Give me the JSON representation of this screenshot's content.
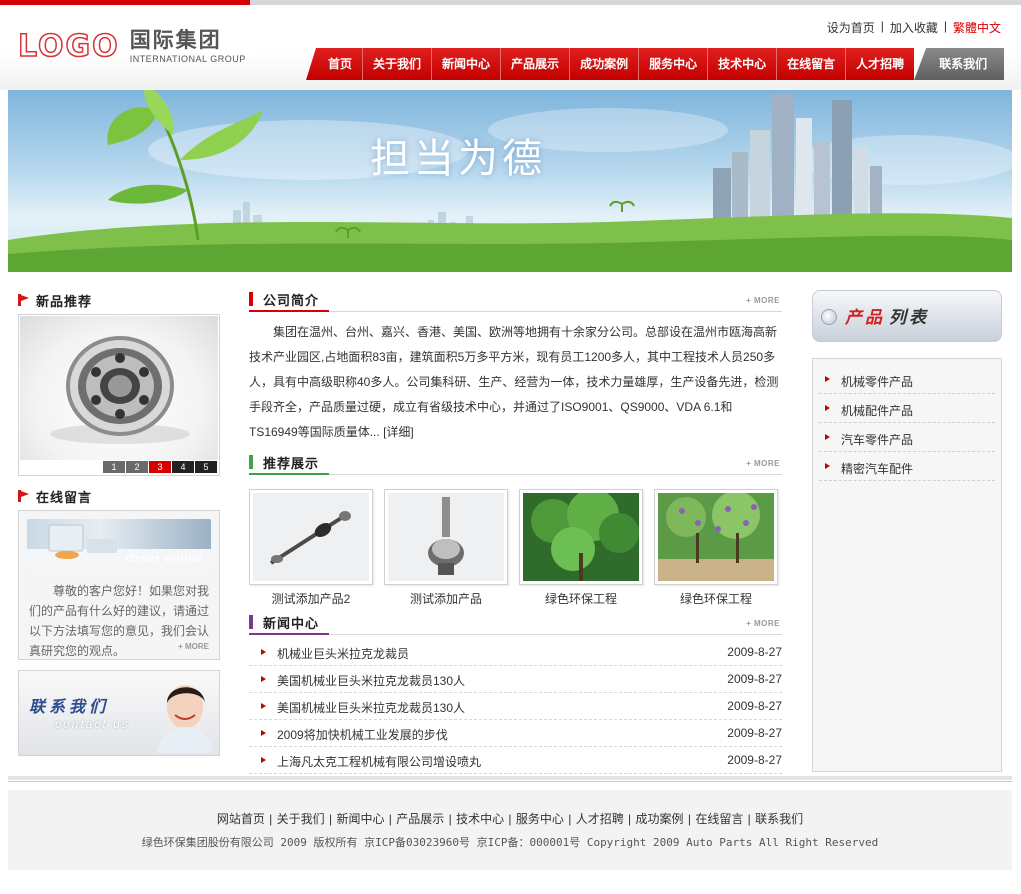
{
  "header": {
    "logo_mark": "LOGO",
    "logo_cn": "国际集团",
    "logo_en": "INTERNATIONAL GROUP",
    "top_links": [
      "设为首页",
      "加入收藏",
      "繁體中文"
    ],
    "nav": [
      "首页",
      "关于我们",
      "新闻中心",
      "产品展示",
      "成功案例",
      "服务中心",
      "技术中心",
      "在线留言",
      "人才招聘"
    ],
    "nav_contact": "联系我们"
  },
  "banner": {
    "slogan": "担当为德"
  },
  "left": {
    "new_products_title": "新品推荐",
    "slide_numbers": [
      "1",
      "2",
      "3",
      "4",
      "5"
    ],
    "active_slide": 3,
    "message_title": "在线留言",
    "order_online": "Order online",
    "message_text": "尊敬的客户您好！如果您对我们的产品有什么好的建议，请通过以下方法填写您的意见，我们会认真研究您的观点。",
    "message_more": "+ MORE",
    "contact_cn": "联系我们",
    "contact_en": "contact us"
  },
  "intro": {
    "title": "公司简介",
    "more": "+ MORE",
    "text": "集团在温州、台州、嘉兴、香港、美国、欧洲等地拥有十余家分公司。总部设在温州市瓯海高新技术产业园区,占地面积83亩，建筑面积5万多平方米，现有员工1200多人，其中工程技术人员250多人，具有中高级职称40多人。公司集科研、生产、经营为一体，技术力量雄厚，生产设备先进，检测手段齐全，产品质量过硬，成立有省级技术中心，并通过了ISO9001、QS9000、VDA 6.1和TS16949等国际质量体...",
    "detail": "[详细]"
  },
  "showcase": {
    "title": "推荐展示",
    "more": "+ MORE",
    "items": [
      {
        "label": "测试添加产品2",
        "icon": "cv-axle-image"
      },
      {
        "label": "测试添加产品",
        "icon": "cv-joint-image"
      },
      {
        "label": "绿色环保工程",
        "icon": "green-tree-image"
      },
      {
        "label": "绿色环保工程",
        "icon": "flower-tree-image"
      }
    ]
  },
  "news": {
    "title": "新闻中心",
    "more": "+ MORE",
    "items": [
      {
        "title": "机械业巨头米拉克龙裁员",
        "date": "2009-8-27"
      },
      {
        "title": "美国机械业巨头米拉克龙裁员130人",
        "date": "2009-8-27"
      },
      {
        "title": "美国机械业巨头米拉克龙裁员130人",
        "date": "2009-8-27"
      },
      {
        "title": "2009将加快机械工业发展的步伐",
        "date": "2009-8-27"
      },
      {
        "title": "上海凡太克工程机械有限公司增设喷丸",
        "date": "2009-8-27"
      }
    ]
  },
  "product_list": {
    "title_a": "产品",
    "title_b": "列表",
    "items": [
      "机械零件产品",
      "机械配件产品",
      "汽车零件产品",
      "精密汽车配件"
    ]
  },
  "footer": {
    "links": [
      "网站首页",
      "关于我们",
      "新闻中心",
      "产品展示",
      "技术中心",
      "服务中心",
      "人才招聘",
      "成功案例",
      "在线留言",
      "联系我们"
    ],
    "copyright": "绿色环保集团股份有限公司 2009 版权所有 京ICP备03023960号 京ICP备：000001号 Copyright 2009 Auto Parts All Right Reserved"
  },
  "colors": {
    "brand_red": "#d60000",
    "nav_gray": "#6f6f6f",
    "news_bar": "#7a3a8c",
    "show_bar": "#3fa34d"
  }
}
